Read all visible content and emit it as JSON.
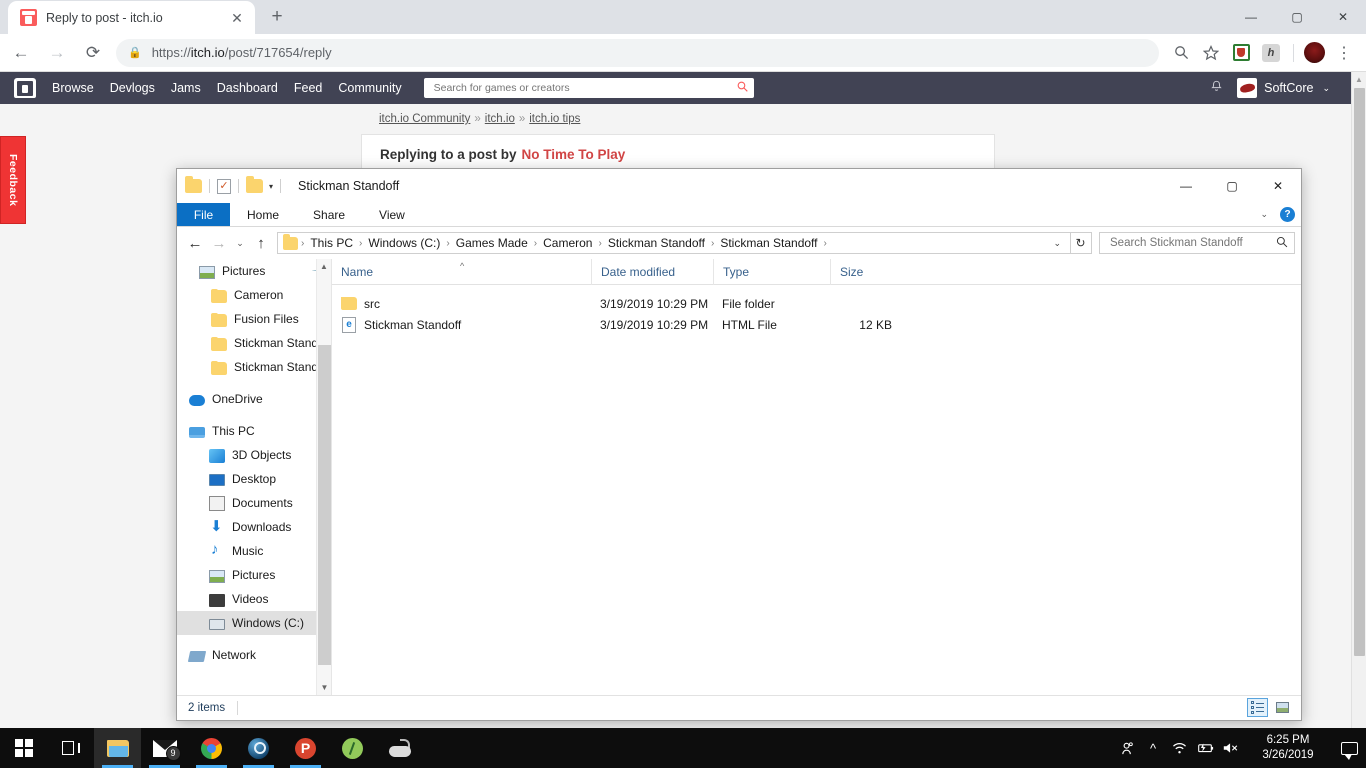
{
  "browser": {
    "tab": {
      "title": "Reply to post - itch.io",
      "favicon": "itch-io-favicon",
      "close_label": "✕"
    },
    "new_tab_label": "+",
    "window_controls": {
      "minimize": "—",
      "maximize": "▢",
      "close": "✕"
    },
    "nav": {
      "back": "←",
      "forward": "→",
      "reload": "⟳"
    },
    "omnibox": {
      "lock_icon": "lock-icon",
      "url_scheme": "https://",
      "url_host": "itch.io",
      "url_path": "/post/717654/reply"
    },
    "toolbar_icons": [
      "search-icon",
      "bookmark-star-icon",
      "ublock-extension-icon",
      "h-extension-icon",
      "profile-avatar",
      "chrome-menu-icon"
    ],
    "kebab": "⋮"
  },
  "itch": {
    "logo": "itch-io-logo",
    "nav_links": [
      "Browse",
      "Devlogs",
      "Jams",
      "Dashboard",
      "Feed",
      "Community"
    ],
    "search_placeholder": "Search for games or creators",
    "search_value": "",
    "bell_icon": "notification-bell-icon",
    "user_name": "SoftCore",
    "user_caret": "⌄",
    "breadcrumb": [
      "itch.io Community",
      "itch.io",
      "itch.io tips"
    ],
    "breadcrumb_sep": "»",
    "reply_label": "Replying to a post by",
    "reply_author": "No Time To Play",
    "feedback_tab": "Feedback"
  },
  "explorer": {
    "quick_access": {
      "folder_icon": "folder-icon",
      "properties_icon": "properties-checkbox-icon",
      "new_folder_icon": "new-folder-icon",
      "caret": "▾"
    },
    "title": "Stickman Standoff",
    "window_controls": {
      "minimize": "—",
      "maximize": "▢",
      "close": "✕"
    },
    "ribbon_tabs": [
      "File",
      "Home",
      "Share",
      "View"
    ],
    "ribbon_collapse": "⌄",
    "help_label": "?",
    "address": {
      "back": "←",
      "forward": "→",
      "recent": "⌄",
      "up": "↑",
      "folder_icon": "folder-icon",
      "crumbs": [
        "This PC",
        "Windows (C:)",
        "Games Made",
        "Cameron",
        "Stickman Standoff",
        "Stickman Standoff"
      ],
      "crumb_sep": "›",
      "dropdown": "⌄",
      "refresh": "↻",
      "search_placeholder": "Search Stickman Standoff",
      "search_value": ""
    },
    "nav_pane": {
      "items": [
        {
          "label": "Pictures",
          "icon": "pictures-icon",
          "indent": 1,
          "pinned": true,
          "selected": false
        },
        {
          "label": "Cameron",
          "icon": "folder-icon",
          "indent": 1,
          "pinned": false,
          "selected": false
        },
        {
          "label": "Fusion Files",
          "icon": "folder-icon",
          "indent": 1,
          "pinned": false,
          "selected": false
        },
        {
          "label": "Stickman Standoff",
          "icon": "folder-icon",
          "indent": 1,
          "pinned": false,
          "selected": false
        },
        {
          "label": "Stickman Standoff",
          "icon": "folder-icon",
          "indent": 1,
          "pinned": false,
          "selected": false
        },
        {
          "label": "OneDrive",
          "icon": "onedrive-icon",
          "indent": 0,
          "pinned": false,
          "selected": false
        },
        {
          "label": "This PC",
          "icon": "this-pc-icon",
          "indent": 0,
          "pinned": false,
          "selected": false
        },
        {
          "label": "3D Objects",
          "icon": "3d-objects-icon",
          "indent": 1,
          "pinned": false,
          "selected": false
        },
        {
          "label": "Desktop",
          "icon": "desktop-icon",
          "indent": 1,
          "pinned": false,
          "selected": false
        },
        {
          "label": "Documents",
          "icon": "documents-icon",
          "indent": 1,
          "pinned": false,
          "selected": false
        },
        {
          "label": "Downloads",
          "icon": "downloads-icon",
          "indent": 1,
          "pinned": false,
          "selected": false
        },
        {
          "label": "Music",
          "icon": "music-icon",
          "indent": 1,
          "pinned": false,
          "selected": false
        },
        {
          "label": "Pictures",
          "icon": "pictures-icon",
          "indent": 1,
          "pinned": false,
          "selected": false
        },
        {
          "label": "Videos",
          "icon": "videos-icon",
          "indent": 1,
          "pinned": false,
          "selected": false
        },
        {
          "label": "Windows (C:)",
          "icon": "drive-icon",
          "indent": 1,
          "pinned": false,
          "selected": true
        },
        {
          "label": "Network",
          "icon": "network-icon",
          "indent": 0,
          "pinned": false,
          "selected": false
        }
      ]
    },
    "columns": [
      "Name",
      "Date modified",
      "Type",
      "Size"
    ],
    "sort_indicator": "^",
    "rows": [
      {
        "name": "src",
        "date_modified": "3/19/2019 10:29 PM",
        "type": "File folder",
        "size": "",
        "icon": "folder-icon"
      },
      {
        "name": "Stickman Standoff",
        "date_modified": "3/19/2019 10:29 PM",
        "type": "HTML File",
        "size": "12 KB",
        "icon": "html-file-icon"
      }
    ],
    "status": "2 items",
    "view_buttons": {
      "details": "details-view-icon",
      "large_icons": "large-icons-view-icon"
    }
  },
  "taskbar": {
    "items": [
      {
        "name": "start-button",
        "icon": "windows-logo-icon",
        "running": false,
        "active": false
      },
      {
        "name": "task-view-button",
        "icon": "task-view-icon",
        "running": false,
        "active": false
      },
      {
        "name": "file-explorer-button",
        "icon": "file-explorer-icon",
        "running": true,
        "active": true
      },
      {
        "name": "mail-button",
        "icon": "mail-icon",
        "running": true,
        "active": false,
        "badge": "9"
      },
      {
        "name": "chrome-button",
        "icon": "chrome-icon",
        "running": true,
        "active": false
      },
      {
        "name": "steam-button",
        "icon": "steam-icon",
        "running": true,
        "active": false
      },
      {
        "name": "paint-dot-net-button",
        "icon": "p-app-icon",
        "running": true,
        "active": false
      },
      {
        "name": "android-studio-button",
        "icon": "android-studio-icon",
        "running": false,
        "active": false
      },
      {
        "name": "gamepad-app-button",
        "icon": "gamepad-icon",
        "running": false,
        "active": false
      }
    ],
    "tray": [
      "people-icon",
      "show-hidden-icons-icon",
      "wifi-icon",
      "battery-icon",
      "volume-muted-icon"
    ],
    "time": "6:25 PM",
    "date": "3/26/2019",
    "action_center": "action-center-icon"
  }
}
